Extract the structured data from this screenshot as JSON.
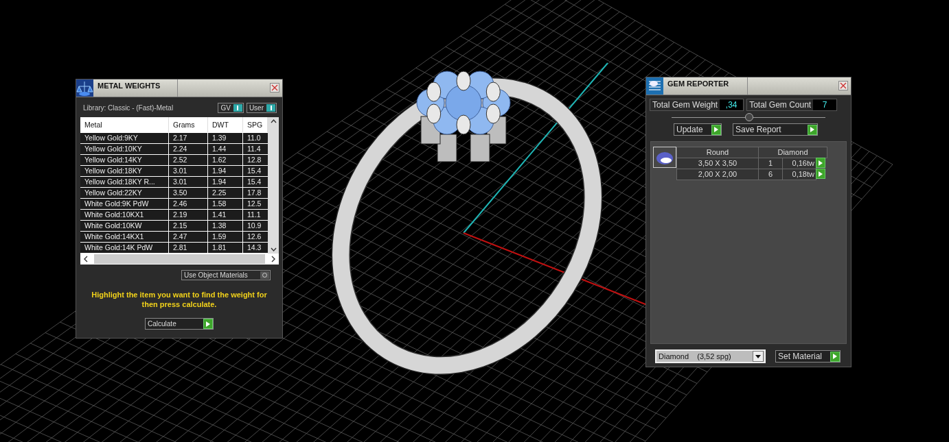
{
  "metal_weights": {
    "title": "METAL WEIGHTS",
    "library": "Library: Classic - (Fast)-Metal",
    "toggles": [
      {
        "label": "GV",
        "on": true
      },
      {
        "label": "User",
        "on": true
      }
    ],
    "table": {
      "columns": [
        "Metal",
        "Grams",
        "DWT",
        "SPG"
      ],
      "rows": [
        [
          "Yellow Gold:9KY",
          "2.17",
          "1.39",
          "11.0"
        ],
        [
          "Yellow Gold:10KY",
          "2.24",
          "1.44",
          "11.4"
        ],
        [
          "Yellow Gold:14KY",
          "2.52",
          "1.62",
          "12.8"
        ],
        [
          "Yellow Gold:18KY",
          "3.01",
          "1.94",
          "15.4"
        ],
        [
          "Yellow Gold:18KY R...",
          "3.01",
          "1.94",
          "15.4"
        ],
        [
          "Yellow Gold:22KY",
          "3.50",
          "2.25",
          "17.8"
        ],
        [
          "White Gold:9K PdW",
          "2.46",
          "1.58",
          "12.5"
        ],
        [
          "White Gold:10KX1",
          "2.19",
          "1.41",
          "11.1"
        ],
        [
          "White Gold:10KW",
          "2.15",
          "1.38",
          "10.9"
        ],
        [
          "White Gold:14KX1",
          "2.47",
          "1.59",
          "12.6"
        ],
        [
          "White Gold:14K PdW",
          "2.81",
          "1.81",
          "14.3"
        ]
      ]
    },
    "use_object_materials": {
      "label": "Use Object Materials",
      "on": false
    },
    "hint": "Highlight the item you want to find the weight for then press calculate.",
    "calculate_button": "Calculate"
  },
  "gem_reporter": {
    "title": "GEM REPORTER",
    "total_weight": {
      "label": "Total Gem Weight",
      "value": ",34"
    },
    "total_count": {
      "label": "Total Gem Count",
      "value": "7"
    },
    "buttons": [
      "Update",
      "Save Report"
    ],
    "table": {
      "shape": "Round",
      "material": "Diamond",
      "rows": [
        {
          "size": "3,50 X 3,50",
          "count": "1",
          "weight": "0,16tw"
        },
        {
          "size": "2,00 X 2,00",
          "count": "6",
          "weight": "0,18tw"
        }
      ]
    },
    "material_select": {
      "value": "Diamond    (3,52 spg)"
    },
    "set_material_button": "Set Material"
  }
}
